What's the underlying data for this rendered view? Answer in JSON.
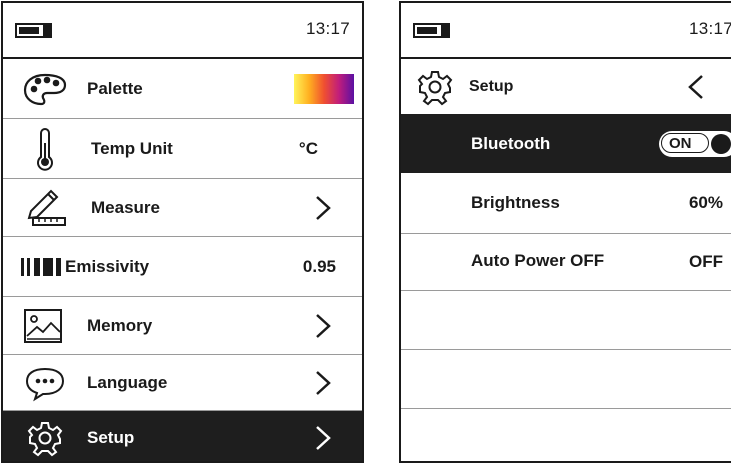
{
  "left_screen": {
    "status": {
      "time": "13:17",
      "battery_level": 0.9
    },
    "items": [
      {
        "label": "Palette",
        "icon": "palette-icon",
        "value": "",
        "control": "palette-gradient"
      },
      {
        "label": "Temp Unit",
        "icon": "thermometer-icon",
        "value": "°C",
        "control": "value"
      },
      {
        "label": "Measure",
        "icon": "pencil-ruler-icon",
        "value": "",
        "control": "chevron"
      },
      {
        "label": "Emissivity",
        "icon": "emissivity-bars-icon",
        "value": "0.95",
        "control": "value"
      },
      {
        "label": "Memory",
        "icon": "image-icon",
        "value": "",
        "control": "chevron"
      },
      {
        "label": "Language",
        "icon": "speech-bubble-icon",
        "value": "",
        "control": "chevron"
      },
      {
        "label": "Setup",
        "icon": "gear-icon",
        "value": "",
        "control": "chevron",
        "selected": true
      }
    ]
  },
  "right_screen": {
    "status": {
      "time": "13:17",
      "battery_level": 0.9
    },
    "header": {
      "title": "Setup",
      "icon": "gear-icon",
      "back_icon": "chevron-left-icon"
    },
    "items": [
      {
        "label": "Bluetooth",
        "value": "ON",
        "control": "toggle",
        "selected": true
      },
      {
        "label": "Brightness",
        "value": "60%",
        "control": "value"
      },
      {
        "label": "Auto Power OFF",
        "value": "OFF",
        "control": "value"
      }
    ]
  },
  "colors": {
    "selected_row_bg": "#1e1e1e",
    "text": "#1a1a1a",
    "separator": "#9a9a9a"
  }
}
